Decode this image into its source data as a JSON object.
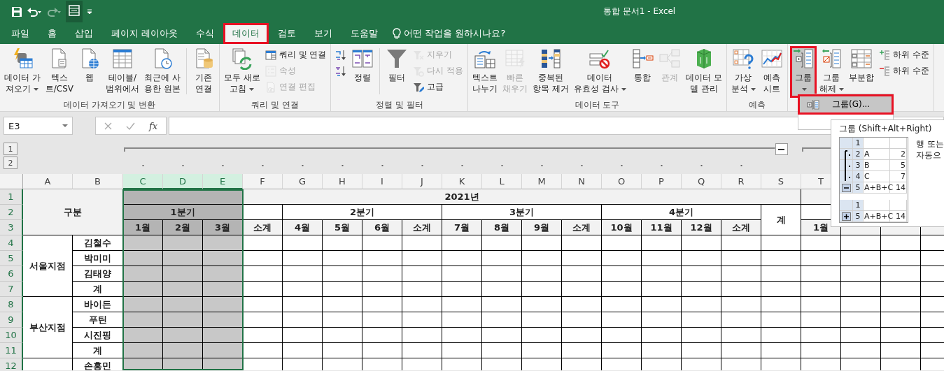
{
  "title_bar": {
    "title": "통합 문서1  -  Excel"
  },
  "tabs": [
    {
      "label": "파일",
      "selected": false,
      "highlighted": false
    },
    {
      "label": "홈",
      "selected": false,
      "highlighted": false
    },
    {
      "label": "삽입",
      "selected": false,
      "highlighted": false
    },
    {
      "label": "페이지 레이아웃",
      "selected": false,
      "highlighted": false
    },
    {
      "label": "수식",
      "selected": false,
      "highlighted": false
    },
    {
      "label": "데이터",
      "selected": true,
      "highlighted": true
    },
    {
      "label": "검토",
      "selected": false,
      "highlighted": false
    },
    {
      "label": "보기",
      "selected": false,
      "highlighted": false
    },
    {
      "label": "도움말",
      "selected": false,
      "highlighted": false
    }
  ],
  "tell_me": "어떤 작업을 원하시나요?",
  "ribbon": {
    "groups": [
      {
        "label": "데이터 가져오기 및 변환",
        "items": [
          {
            "kind": "large",
            "lines": [
              "데이터 가",
              "져오기"
            ],
            "dropdown": true,
            "disabled": false
          },
          {
            "kind": "large",
            "lines": [
              "텍스",
              "트/CSV"
            ],
            "dropdown": false,
            "disabled": false
          },
          {
            "kind": "large",
            "lines": [
              "웹"
            ],
            "dropdown": false,
            "disabled": false
          },
          {
            "kind": "large",
            "lines": [
              "테이블/",
              "범위에서"
            ],
            "dropdown": false,
            "disabled": false
          },
          {
            "kind": "large",
            "lines": [
              "최근에 사",
              "용한 원본"
            ],
            "dropdown": false,
            "disabled": false
          },
          {
            "kind": "separator"
          },
          {
            "kind": "large",
            "lines": [
              "기존",
              "연결"
            ],
            "dropdown": false,
            "disabled": false
          }
        ]
      },
      {
        "label": "쿼리 및 연결",
        "items": [
          {
            "kind": "large",
            "lines": [
              "모두 새로",
              "고침"
            ],
            "dropdown": true,
            "disabled": false
          },
          {
            "kind": "stack",
            "items": [
              {
                "label": "쿼리 및 연결",
                "disabled": false
              },
              {
                "label": "속성",
                "disabled": true
              },
              {
                "label": "연결 편집",
                "disabled": true
              }
            ]
          }
        ]
      },
      {
        "label": "정렬 및 필터",
        "items": [
          {
            "kind": "stack",
            "items": [
              {
                "disabled": false
              },
              {
                "disabled": false
              }
            ]
          },
          {
            "kind": "large",
            "lines": [
              "정렬"
            ],
            "dropdown": false,
            "disabled": false
          },
          {
            "kind": "separator"
          },
          {
            "kind": "large",
            "lines": [
              "필터"
            ],
            "dropdown": false,
            "disabled": false
          },
          {
            "kind": "stack",
            "items": [
              {
                "label": "지우기",
                "disabled": true
              },
              {
                "label": "다시 적용",
                "disabled": true
              },
              {
                "label": "고급",
                "disabled": false
              }
            ]
          }
        ]
      },
      {
        "label": "데이터 도구",
        "items": [
          {
            "kind": "large",
            "lines": [
              "텍스트",
              "나누기"
            ],
            "dropdown": false,
            "disabled": false
          },
          {
            "kind": "large",
            "lines": [
              "빠른",
              "채우기"
            ],
            "dropdown": false,
            "disabled": true
          },
          {
            "kind": "large",
            "lines": [
              "중복된",
              "항목 제거"
            ],
            "dropdown": false,
            "disabled": false
          },
          {
            "kind": "large",
            "lines": [
              "데이터",
              "유효성 검사"
            ],
            "dropdown": true,
            "disabled": false
          },
          {
            "kind": "large",
            "lines": [
              "통합"
            ],
            "dropdown": false,
            "disabled": false
          },
          {
            "kind": "large",
            "lines": [
              "관계"
            ],
            "dropdown": false,
            "disabled": true
          },
          {
            "kind": "large",
            "lines": [
              "데이터 모",
              "델 관리"
            ],
            "dropdown": false,
            "disabled": false
          }
        ]
      },
      {
        "label": "예측",
        "items": [
          {
            "kind": "large",
            "lines": [
              "가상",
              "분석"
            ],
            "dropdown": true,
            "disabled": false
          },
          {
            "kind": "large",
            "lines": [
              "예측",
              "시트"
            ],
            "dropdown": false,
            "disabled": false
          }
        ]
      },
      {
        "items": [
          {
            "kind": "large",
            "lines": [
              "그룹"
            ],
            "dropdown": true,
            "disabled": false,
            "pressed": true,
            "highlighted": true
          },
          {
            "kind": "large",
            "lines": [
              "그룹",
              "해제"
            ],
            "dropdown": true,
            "disabled": false,
            "pressed": false,
            "highlighted": false
          },
          {
            "kind": "large",
            "lines": [
              "부분합"
            ],
            "dropdown": false,
            "disabled": false,
            "pressed": false,
            "highlighted": false
          },
          {
            "kind": "stack",
            "items": [
              {
                "label": "하위 수준",
                "disabled": false
              },
              {
                "label": "하위 수준",
                "disabled": false
              }
            ]
          }
        ]
      }
    ]
  },
  "menu": {
    "items": [
      {
        "label": "그룹(G)...",
        "selected": true,
        "highlighted": true
      }
    ]
  },
  "tooltip": {
    "title": "그룹 (Shift+Alt+Right)",
    "expanded_rows": [
      {
        "num": "1"
      },
      {
        "num": "2",
        "label": "A",
        "value": "2"
      },
      {
        "num": "3",
        "label": "B",
        "value": "5"
      },
      {
        "num": "4",
        "label": "C",
        "value": "7"
      },
      {
        "num": "5",
        "label": "A+B+C",
        "value": "14"
      }
    ],
    "collapsed_rows": [
      {
        "num": "1"
      },
      {
        "num": "5",
        "label": "A+B+C",
        "value": "14"
      }
    ],
    "description": [
      "행 또는",
      "자동으"
    ]
  },
  "formula_bar": {
    "name_box": "E3",
    "function_label": "fx"
  },
  "outline": {
    "levels": [
      "1",
      "2"
    ]
  },
  "sheet": {
    "columns": [
      {
        "letter": "A",
        "selected": false
      },
      {
        "letter": "B",
        "selected": false
      },
      {
        "letter": "C",
        "selected": true
      },
      {
        "letter": "D",
        "selected": true
      },
      {
        "letter": "E",
        "selected": true
      },
      {
        "letter": "F",
        "selected": false
      },
      {
        "letter": "G",
        "selected": false
      },
      {
        "letter": "H",
        "selected": false
      },
      {
        "letter": "I",
        "selected": false
      },
      {
        "letter": "J",
        "selected": false
      },
      {
        "letter": "K",
        "selected": false
      },
      {
        "letter": "L",
        "selected": false
      },
      {
        "letter": "M",
        "selected": false
      },
      {
        "letter": "N",
        "selected": false
      },
      {
        "letter": "O",
        "selected": false
      },
      {
        "letter": "P",
        "selected": false
      },
      {
        "letter": "Q",
        "selected": false
      },
      {
        "letter": "R",
        "selected": false
      },
      {
        "letter": "S",
        "selected": false
      },
      {
        "letter": "T",
        "selected": false
      }
    ],
    "rows": [
      "1",
      "2",
      "3",
      "4",
      "5",
      "6",
      "7",
      "8",
      "9",
      "10",
      "11",
      "12"
    ],
    "header": {
      "label": "구분",
      "year": "2021년",
      "total": "계",
      "next_months": [
        "1월"
      ],
      "quarters": [
        {
          "label": "1분기",
          "months": [
            "1월",
            "2월",
            "3월"
          ],
          "subtotal": "소계",
          "heading_spans_subtotal": false
        },
        {
          "label": "2분기",
          "months": [
            "4월",
            "5월",
            "6월"
          ],
          "subtotal": "소계",
          "heading_spans_subtotal": true
        },
        {
          "label": "3분기",
          "months": [
            "7월",
            "8월",
            "9월"
          ],
          "subtotal": "소계",
          "heading_spans_subtotal": true
        },
        {
          "label": "4분기",
          "months": [
            "10월",
            "11월",
            "12월"
          ],
          "subtotal": "소계",
          "heading_spans_subtotal": true
        }
      ]
    },
    "branches": [
      {
        "name": "서울지점",
        "people": [
          "김철수",
          "박미미",
          "김태양"
        ],
        "total": "계"
      },
      {
        "name": "부산지점",
        "people": [
          "바이든",
          "푸틴",
          "시진핑"
        ],
        "total": "계"
      },
      {
        "people": [
          "손흥민"
        ]
      }
    ]
  }
}
